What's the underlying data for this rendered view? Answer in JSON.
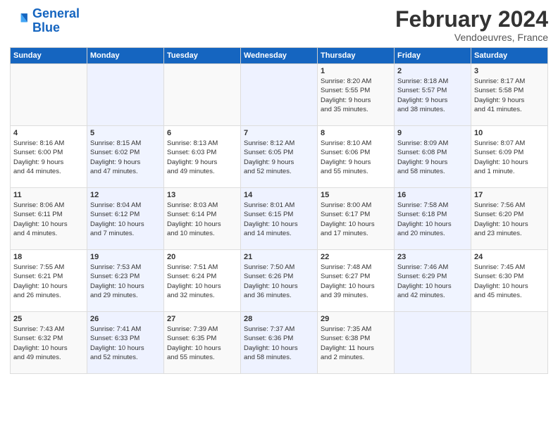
{
  "header": {
    "logo_line1": "General",
    "logo_line2": "Blue",
    "title": "February 2024",
    "subtitle": "Vendoeuvres, France"
  },
  "days_of_week": [
    "Sunday",
    "Monday",
    "Tuesday",
    "Wednesday",
    "Thursday",
    "Friday",
    "Saturday"
  ],
  "weeks": [
    {
      "cells": [
        {
          "day": "",
          "content": ""
        },
        {
          "day": "",
          "content": ""
        },
        {
          "day": "",
          "content": ""
        },
        {
          "day": "",
          "content": ""
        },
        {
          "day": "1",
          "content": "Sunrise: 8:20 AM\nSunset: 5:55 PM\nDaylight: 9 hours\nand 35 minutes."
        },
        {
          "day": "2",
          "content": "Sunrise: 8:18 AM\nSunset: 5:57 PM\nDaylight: 9 hours\nand 38 minutes."
        },
        {
          "day": "3",
          "content": "Sunrise: 8:17 AM\nSunset: 5:58 PM\nDaylight: 9 hours\nand 41 minutes."
        }
      ]
    },
    {
      "cells": [
        {
          "day": "4",
          "content": "Sunrise: 8:16 AM\nSunset: 6:00 PM\nDaylight: 9 hours\nand 44 minutes."
        },
        {
          "day": "5",
          "content": "Sunrise: 8:15 AM\nSunset: 6:02 PM\nDaylight: 9 hours\nand 47 minutes."
        },
        {
          "day": "6",
          "content": "Sunrise: 8:13 AM\nSunset: 6:03 PM\nDaylight: 9 hours\nand 49 minutes."
        },
        {
          "day": "7",
          "content": "Sunrise: 8:12 AM\nSunset: 6:05 PM\nDaylight: 9 hours\nand 52 minutes."
        },
        {
          "day": "8",
          "content": "Sunrise: 8:10 AM\nSunset: 6:06 PM\nDaylight: 9 hours\nand 55 minutes."
        },
        {
          "day": "9",
          "content": "Sunrise: 8:09 AM\nSunset: 6:08 PM\nDaylight: 9 hours\nand 58 minutes."
        },
        {
          "day": "10",
          "content": "Sunrise: 8:07 AM\nSunset: 6:09 PM\nDaylight: 10 hours\nand 1 minute."
        }
      ]
    },
    {
      "cells": [
        {
          "day": "11",
          "content": "Sunrise: 8:06 AM\nSunset: 6:11 PM\nDaylight: 10 hours\nand 4 minutes."
        },
        {
          "day": "12",
          "content": "Sunrise: 8:04 AM\nSunset: 6:12 PM\nDaylight: 10 hours\nand 7 minutes."
        },
        {
          "day": "13",
          "content": "Sunrise: 8:03 AM\nSunset: 6:14 PM\nDaylight: 10 hours\nand 10 minutes."
        },
        {
          "day": "14",
          "content": "Sunrise: 8:01 AM\nSunset: 6:15 PM\nDaylight: 10 hours\nand 14 minutes."
        },
        {
          "day": "15",
          "content": "Sunrise: 8:00 AM\nSunset: 6:17 PM\nDaylight: 10 hours\nand 17 minutes."
        },
        {
          "day": "16",
          "content": "Sunrise: 7:58 AM\nSunset: 6:18 PM\nDaylight: 10 hours\nand 20 minutes."
        },
        {
          "day": "17",
          "content": "Sunrise: 7:56 AM\nSunset: 6:20 PM\nDaylight: 10 hours\nand 23 minutes."
        }
      ]
    },
    {
      "cells": [
        {
          "day": "18",
          "content": "Sunrise: 7:55 AM\nSunset: 6:21 PM\nDaylight: 10 hours\nand 26 minutes."
        },
        {
          "day": "19",
          "content": "Sunrise: 7:53 AM\nSunset: 6:23 PM\nDaylight: 10 hours\nand 29 minutes."
        },
        {
          "day": "20",
          "content": "Sunrise: 7:51 AM\nSunset: 6:24 PM\nDaylight: 10 hours\nand 32 minutes."
        },
        {
          "day": "21",
          "content": "Sunrise: 7:50 AM\nSunset: 6:26 PM\nDaylight: 10 hours\nand 36 minutes."
        },
        {
          "day": "22",
          "content": "Sunrise: 7:48 AM\nSunset: 6:27 PM\nDaylight: 10 hours\nand 39 minutes."
        },
        {
          "day": "23",
          "content": "Sunrise: 7:46 AM\nSunset: 6:29 PM\nDaylight: 10 hours\nand 42 minutes."
        },
        {
          "day": "24",
          "content": "Sunrise: 7:45 AM\nSunset: 6:30 PM\nDaylight: 10 hours\nand 45 minutes."
        }
      ]
    },
    {
      "cells": [
        {
          "day": "25",
          "content": "Sunrise: 7:43 AM\nSunset: 6:32 PM\nDaylight: 10 hours\nand 49 minutes."
        },
        {
          "day": "26",
          "content": "Sunrise: 7:41 AM\nSunset: 6:33 PM\nDaylight: 10 hours\nand 52 minutes."
        },
        {
          "day": "27",
          "content": "Sunrise: 7:39 AM\nSunset: 6:35 PM\nDaylight: 10 hours\nand 55 minutes."
        },
        {
          "day": "28",
          "content": "Sunrise: 7:37 AM\nSunset: 6:36 PM\nDaylight: 10 hours\nand 58 minutes."
        },
        {
          "day": "29",
          "content": "Sunrise: 7:35 AM\nSunset: 6:38 PM\nDaylight: 11 hours\nand 2 minutes."
        },
        {
          "day": "",
          "content": ""
        },
        {
          "day": "",
          "content": ""
        }
      ]
    }
  ]
}
